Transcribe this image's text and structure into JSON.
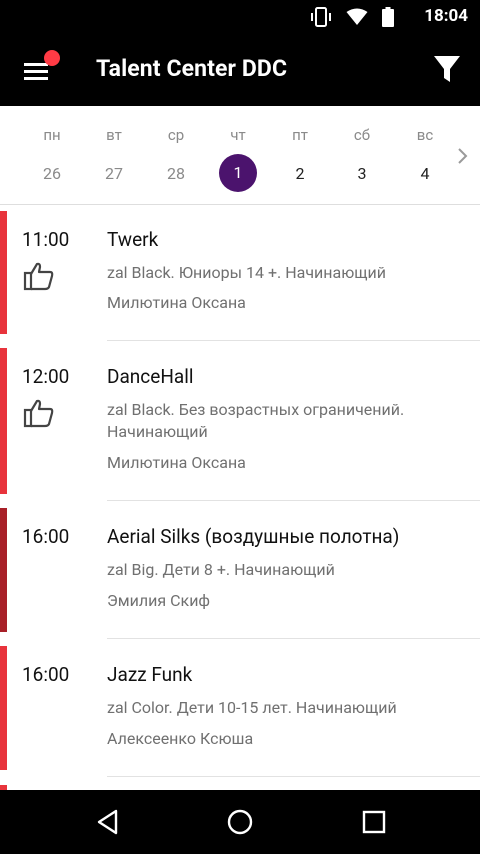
{
  "status_bar": {
    "time": "18:04",
    "icons": [
      "vibrate-icon",
      "wifi-icon",
      "battery-icon"
    ]
  },
  "toolbar": {
    "title": "Talent Center DDC",
    "menu_icon": "menu-icon",
    "filter_icon": "filter-icon",
    "badge_color": "#ff3b45"
  },
  "week": {
    "days": [
      {
        "name": "пн",
        "num": "26",
        "state": "past"
      },
      {
        "name": "вт",
        "num": "27",
        "state": "past"
      },
      {
        "name": "ср",
        "num": "28",
        "state": "past"
      },
      {
        "name": "чт",
        "num": "1",
        "state": "selected"
      },
      {
        "name": "пт",
        "num": "2",
        "state": "future"
      },
      {
        "name": "сб",
        "num": "3",
        "state": "future"
      },
      {
        "name": "вс",
        "num": "4",
        "state": "future"
      }
    ],
    "selected_color": "#4b136d",
    "next_icon": "chevron-right-icon"
  },
  "classes": [
    {
      "time": "11:00",
      "title": "Twerk",
      "info": "zal Black. Юниоры 14 +. Начинающий",
      "teacher": "Милютина Оксана",
      "liked": true,
      "accent": "#e8343c"
    },
    {
      "time": "12:00",
      "title": "DanceHall",
      "info": "zal Black. Без возрастных ограничений. Начинающий",
      "teacher": "Милютина Оксана",
      "liked": true,
      "accent": "#e8343c"
    },
    {
      "time": "16:00",
      "title": "Aerial Silks (воздушные полотна)",
      "info": "zal Big. Дети 8 +. Начинающий",
      "teacher": "Эмилия Скиф",
      "liked": false,
      "accent": "#a82028"
    },
    {
      "time": "16:00",
      "title": "Jazz Funk",
      "info": "zal Color. Дети 10-15 лет. Начинающий",
      "teacher": "Алексеенко Ксюша",
      "liked": false,
      "accent": "#e8343c"
    }
  ],
  "nav_bar": {
    "buttons": [
      "back-icon",
      "home-icon",
      "recents-icon"
    ]
  }
}
